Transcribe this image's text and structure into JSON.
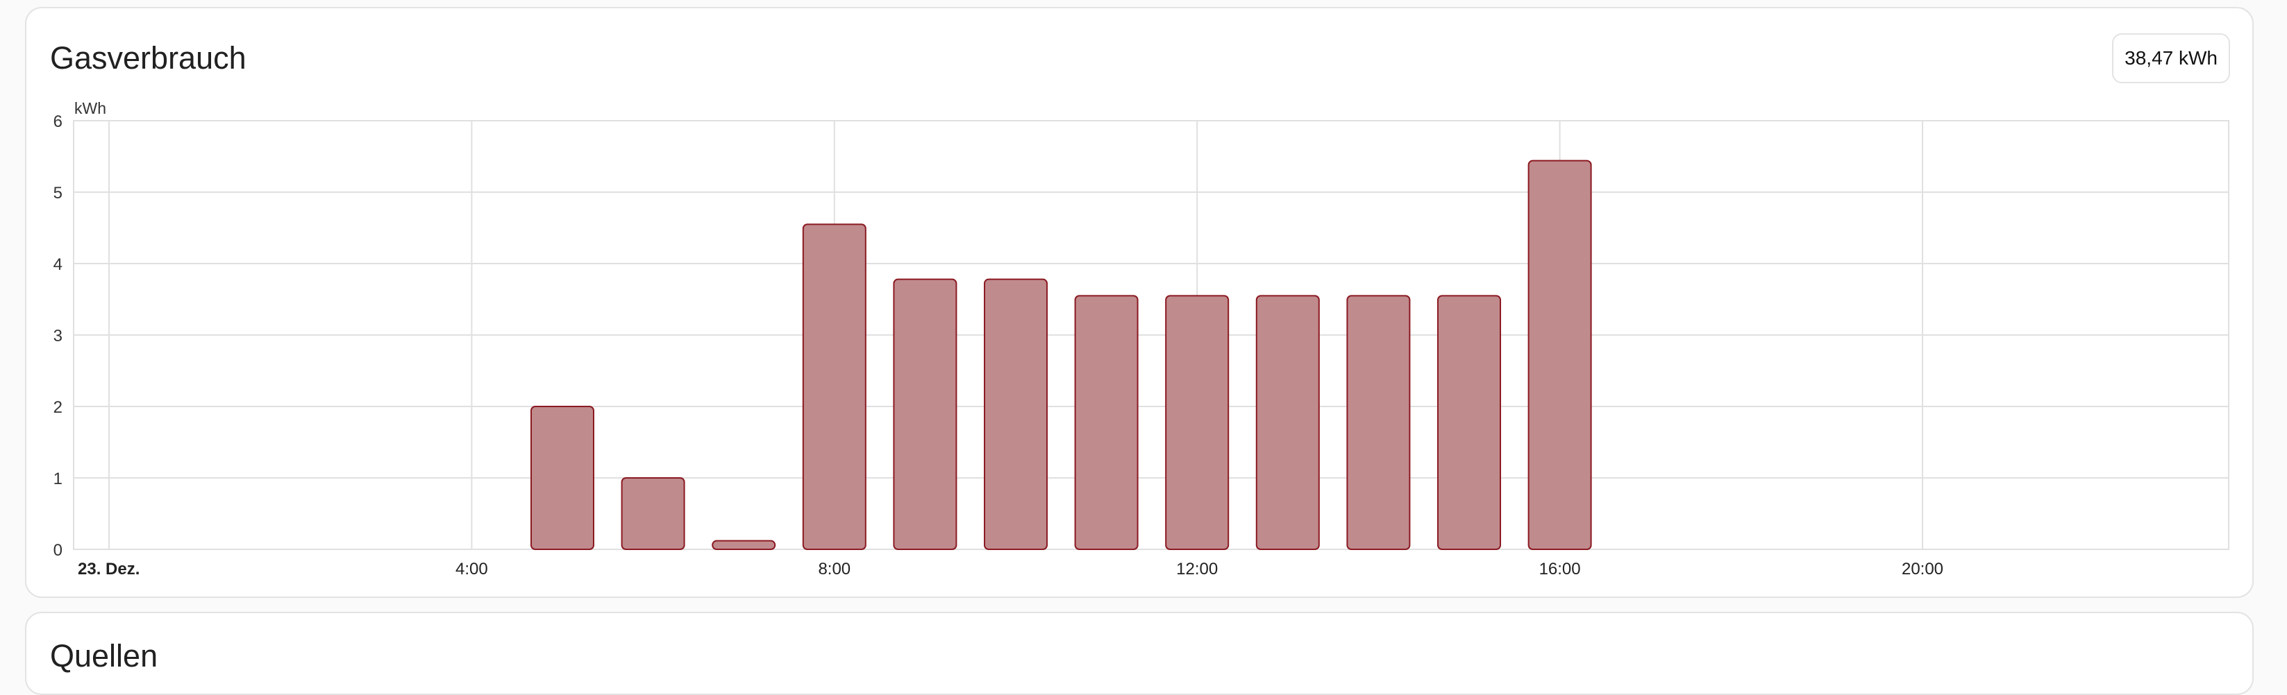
{
  "card": {
    "title": "Gasverbrauch",
    "total": "38,47 kWh"
  },
  "next_card": {
    "title": "Quellen"
  },
  "chart_data": {
    "type": "bar",
    "unit": "kWh",
    "ylim": [
      0,
      6
    ],
    "yticks": [
      0,
      1,
      2,
      3,
      4,
      5,
      6
    ],
    "xlim": [
      "23. Dez. 00:00",
      "23. Dez. 23:59"
    ],
    "x_tick_labels": [
      {
        "hour": 0,
        "label": "23. Dez.",
        "bold": true
      },
      {
        "hour": 4,
        "label": "4:00"
      },
      {
        "hour": 8,
        "label": "8:00"
      },
      {
        "hour": 12,
        "label": "12:00"
      },
      {
        "hour": 16,
        "label": "16:00"
      },
      {
        "hour": 20,
        "label": "20:00"
      }
    ],
    "categories": [
      "5:00",
      "6:00",
      "7:00",
      "8:00",
      "9:00",
      "10:00",
      "11:00",
      "12:00",
      "13:00",
      "14:00",
      "15:00",
      "16:00"
    ],
    "values": [
      2.0,
      1.0,
      0.12,
      4.55,
      3.78,
      3.78,
      3.55,
      3.55,
      3.55,
      3.55,
      3.55,
      5.44
    ],
    "grid": true,
    "colors": {
      "bar_fill": "#c08b8d",
      "bar_stroke": "#8b1a22",
      "grid": "#e0e0e0"
    }
  }
}
